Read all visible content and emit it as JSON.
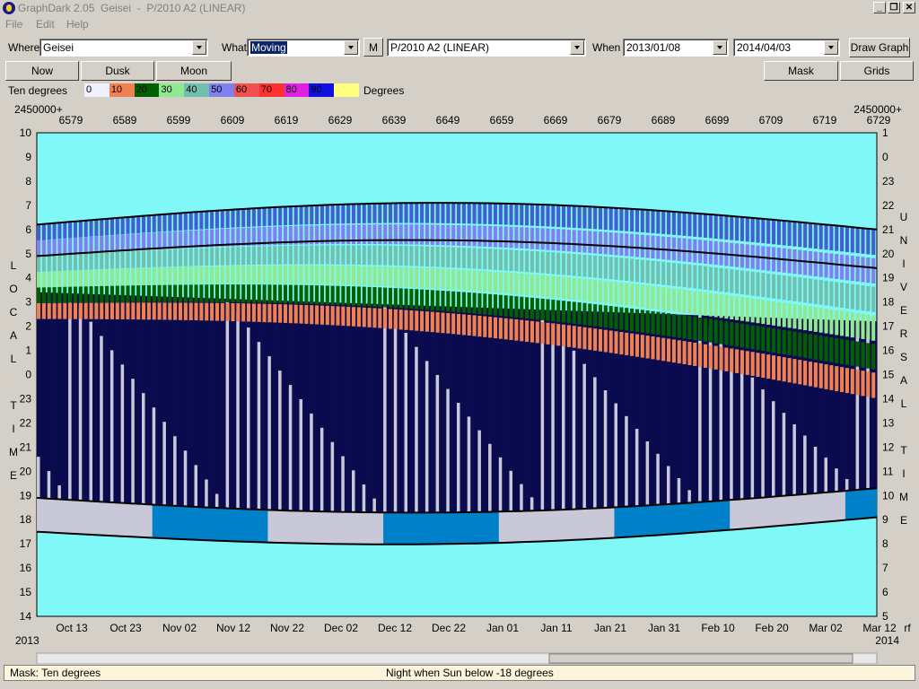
{
  "window": {
    "title": "GraphDark 2.05  Geisei  -  P/2010 A2 (LINEAR)",
    "minimize": "_",
    "maximize": "❐",
    "close": "✕"
  },
  "menu": [
    "File",
    "Edit",
    "Help"
  ],
  "toolbar": {
    "where_label": "Where",
    "where_value": "Geisei",
    "what_label": "What",
    "what_value": "Moving",
    "m_button": "M",
    "object_value": "P/2010 A2 (LINEAR)",
    "when_label": "When",
    "date_from": "2013/01/08",
    "date_to": "2014/04/03",
    "draw_button": "Draw Graph"
  },
  "buttons": {
    "now": "Now",
    "dusk": "Dusk",
    "moon": "Moon",
    "mask": "Mask",
    "grids": "Grids"
  },
  "legend": {
    "label": "Ten degrees",
    "unit": "Degrees",
    "items": [
      {
        "text": "0",
        "color": "#f0f0ff"
      },
      {
        "text": "10",
        "color": "#f08050"
      },
      {
        "text": "20",
        "color": "#006000"
      },
      {
        "text": "30",
        "color": "#90e890"
      },
      {
        "text": "40",
        "color": "#70c0b0"
      },
      {
        "text": "50",
        "color": "#8080f0"
      },
      {
        "text": "60",
        "color": "#f05050"
      },
      {
        "text": "70",
        "color": "#ff3030"
      },
      {
        "text": "80",
        "color": "#e020e0"
      },
      {
        "text": "90",
        "color": "#1010e0"
      },
      {
        "text": "",
        "color": "#ffff80"
      }
    ]
  },
  "chart_data": {
    "type": "heatmap",
    "jd_prefix_left": "2450000+",
    "jd_prefix_right": "2450000+",
    "jd_ticks": [
      "6579",
      "6589",
      "6599",
      "6609",
      "6619",
      "6629",
      "6639",
      "6649",
      "6659",
      "6669",
      "6679",
      "6689",
      "6699",
      "6709",
      "6719",
      "6729"
    ],
    "left_axis_title": [
      "L",
      "O",
      "C",
      "A",
      "L",
      "",
      "T",
      "I",
      "M",
      "E"
    ],
    "right_axis_title": [
      "U",
      "N",
      "I",
      "V",
      "E",
      "R",
      "S",
      "A",
      "L",
      "",
      "T",
      "I",
      "M",
      "E"
    ],
    "local_time_ticks": [
      "10",
      "9",
      "8",
      "7",
      "6",
      "5",
      "4",
      "3",
      "2",
      "1",
      "0",
      "23",
      "22",
      "21",
      "20",
      "19",
      "18",
      "17",
      "16",
      "15",
      "14"
    ],
    "universal_time_ticks": [
      "1",
      "0",
      "23",
      "22",
      "21",
      "20",
      "19",
      "18",
      "17",
      "16",
      "15",
      "14",
      "13",
      "12",
      "11",
      "10",
      "9",
      "8",
      "7",
      "6",
      "5"
    ],
    "date_ticks": [
      "Oct 13",
      "Oct 23",
      "Nov 02",
      "Nov 12",
      "Nov 22",
      "Dec 02",
      "Dec 12",
      "Dec 22",
      "Jan 01",
      "Jan 11",
      "Jan 21",
      "Jan 31",
      "Feb 10",
      "Feb 20",
      "Mar 02",
      "Mar 12"
    ],
    "year_left": "2013",
    "year_right": "2014",
    "corner_label": "rf",
    "colors": {
      "day": "#80f8f8",
      "night": "#0a0a4e",
      "moonlit": "#c8c8d8",
      "twilight": "#0080c8",
      "band_0": "#f08050",
      "band_10": "#f08050",
      "band_20": "#006000",
      "band_30": "#90e890",
      "band_40": "#70c0b0",
      "band_50": "#8080f0",
      "band_60": "#4060d0"
    }
  },
  "status": {
    "mask": "Mask:  Ten degrees",
    "night": "Night when Sun below -18 degrees"
  }
}
